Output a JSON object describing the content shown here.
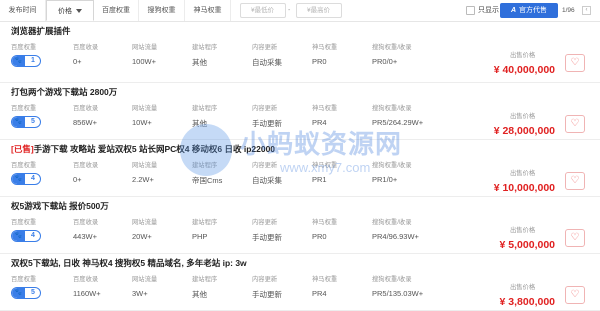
{
  "filters": {
    "tabs": [
      {
        "label": "发布时间"
      },
      {
        "label": "价格"
      },
      {
        "label": "百度权重"
      },
      {
        "label": "搜狗权重"
      },
      {
        "label": "神马权重"
      }
    ],
    "price_min_placeholder": "¥最低价",
    "price_max_placeholder": "¥最高价",
    "price_separator": "-",
    "only_show_label": "只显示",
    "agent_button": {
      "logo": "A",
      "label": "官方代售"
    },
    "pager": {
      "text": "1/96",
      "prev": "‹"
    }
  },
  "columns": {
    "baidu": "百度权重",
    "collected": "百度收录",
    "traffic": "网站流量",
    "program": "建站程序",
    "update": "内容更新",
    "shenma": "神马权重",
    "sogou": "搜狗权重/收录",
    "price": "出售价格"
  },
  "listings": [
    {
      "title": "浏览器扩展插件",
      "sold_tag": "",
      "baidu": "1",
      "collected": "0+",
      "traffic": "100W+",
      "program": "其他",
      "update": "自动采集",
      "shenma": "PR0",
      "sogou": "PR0/0+",
      "price": "¥ 40,000,000"
    },
    {
      "title": "打包两个游戏下载站 2800万",
      "sold_tag": "",
      "baidu": "5",
      "collected": "856W+",
      "traffic": "10W+",
      "program": "其他",
      "update": "手动更新",
      "shenma": "PR4",
      "sogou": "PR5/264.29W+",
      "price": "¥ 28,000,000"
    },
    {
      "title": "手游下载 攻略站 爱站双权5 站长网PC权4 移动权6 日收 ip22000",
      "sold_tag": "[已售]",
      "baidu": "4",
      "collected": "0+",
      "traffic": "2.2W+",
      "program": "帝国Cms",
      "update": "自动采集",
      "shenma": "PR1",
      "sogou": "PR1/0+",
      "price": "¥ 10,000,000"
    },
    {
      "title": "权5游戏下载站 报价500万",
      "sold_tag": "",
      "baidu": "4",
      "collected": "443W+",
      "traffic": "20W+",
      "program": "PHP",
      "update": "手动更新",
      "shenma": "PR0",
      "sogou": "PR4/96.93W+",
      "price": "¥ 5,000,000"
    },
    {
      "title": "双权5下载站, 日收 神马权4 搜狗权5 精品域名, 多年老站 ip: 3w",
      "sold_tag": "",
      "baidu": "5",
      "collected": "1160W+",
      "traffic": "3W+",
      "program": "其他",
      "update": "手动更新",
      "shenma": "PR4",
      "sogou": "PR5/135.03W+",
      "price": "¥ 3,800,000"
    }
  ],
  "icons": {
    "baidu_badge": "paw-icon",
    "favorite": "heart-icon",
    "dropdown": "caret-down-icon"
  },
  "colors": {
    "accent": "#2f6fdb",
    "price": "#e02020",
    "badge": "#3a7ee8"
  },
  "watermark": {
    "text": "小蚂蚁资源网",
    "url": "www.xmy7.com"
  }
}
